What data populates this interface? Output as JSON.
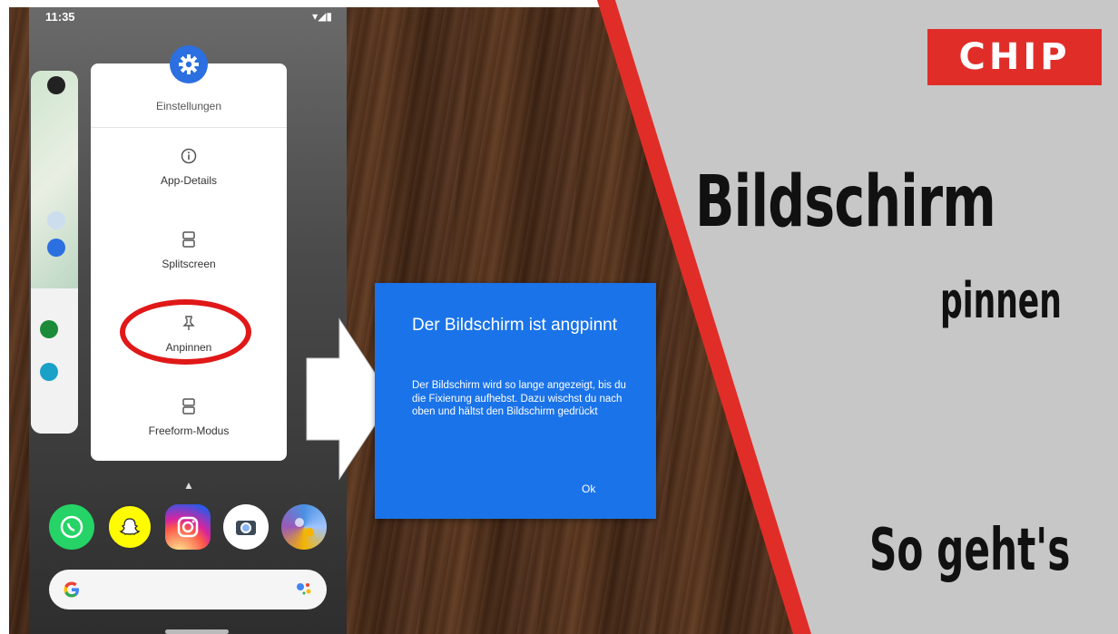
{
  "phone": {
    "status_time": "11:35",
    "menu": {
      "title": "Einstellungen",
      "items": [
        {
          "label": "App-Details",
          "icon": "info-icon"
        },
        {
          "label": "Splitscreen",
          "icon": "split-screen-icon"
        },
        {
          "label": "Anpinnen",
          "icon": "pin-icon"
        },
        {
          "label": "Freeform-Modus",
          "icon": "freeform-icon"
        }
      ]
    },
    "dock_apps": [
      "WhatsApp",
      "Snapchat",
      "Instagram",
      "Camera",
      "Folder"
    ],
    "colors": {
      "gear": "#2b6fe0",
      "highlight": "#e01818"
    }
  },
  "dialog": {
    "title": "Der Bildschirm ist angpinnt",
    "body": "Der Bildschirm wird so lange angezeigt, bis du die Fixierung aufhebst. Dazu wischst du nach oben und hältst den Bildschirm gedrückt",
    "ok_label": "Ok",
    "color": "#1a73e8"
  },
  "brand": {
    "logo": "CHIP",
    "headline": "Bildschirm",
    "subheadline": "pinnen",
    "footer": "So geht's",
    "accent": "#e12d28"
  }
}
